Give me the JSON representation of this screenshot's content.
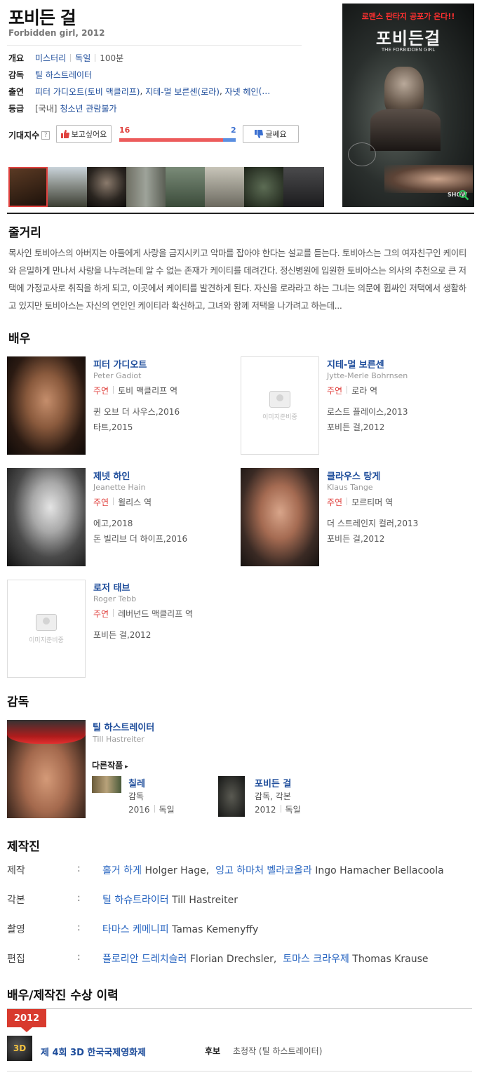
{
  "movie": {
    "title": "포비든 걸",
    "subtitle": "Forbidden girl, 2012"
  },
  "info": {
    "overview_label": "개요",
    "genre": "미스터리",
    "country": "독일",
    "runtime": "100분",
    "director_label": "감독",
    "director": "틸 하스트레이터",
    "cast_label": "출연",
    "cast_line": [
      {
        "name": "피터 가디오트",
        "role": "(토비 맥클리프)"
      },
      {
        "name": "지테-멀 보른센",
        "role": "(로라)"
      },
      {
        "name": "자넷 헤인",
        "role": "(…"
      }
    ],
    "rating_label": "등급",
    "rating_region": "[국내]",
    "rating": "청소년 관람불가"
  },
  "expectation": {
    "label": "기대지수",
    "help": "?",
    "like_button": "보고싶어요",
    "dislike_button": "글쎄요",
    "like_count": "16",
    "dislike_count": "2",
    "like_ratio": 0.89,
    "like_color": "#ec5b5b",
    "dislike_color": "#5a8ee0"
  },
  "poster": {
    "tagline": "로맨스 판타지 공포가 온다!!",
    "title": "포비든걸",
    "eng_title": "THE FORBIDDEN GIRL",
    "corner_logo": "SHOW"
  },
  "synopsis": {
    "heading": "줄거리",
    "text": "목사인 토비아스의 아버지는 아들에게 사랑을 금지시키고 악마를 잡아야 한다는 설교를 듣는다. 토비아스는 그의 여자친구인 케이티와 은밀하게 만나서 사랑을 나누려는데 알 수 없는 존재가 케이티를 데려간다. 정신병원에 입원한 토비아스는 의사의 추천으로 큰 저택에 가정교사로 취직을 하게 되고, 이곳에서 케이티를 발견하게 된다. 자신을 로라라고 하는 그녀는 의문에 휩싸인 저택에서 생활하고 있지만 토비아스는 자신의 연인인 케이티라 확신하고, 그녀와 함께 저택을 나가려고 하는데..."
  },
  "cast": {
    "heading": "배우",
    "no_image_text": "이미지준비중",
    "items": [
      {
        "name": "피터 가디오트",
        "eng": "Peter Gadiot",
        "type": "주연",
        "role": "토비 맥클리프 역",
        "works": [
          "퀸 오브 더 사우스,2016",
          "타트,2015"
        ]
      },
      {
        "name": "지테-멀 보른센",
        "eng": "Jytte-Merle Bohrnsen",
        "type": "주연",
        "role": "로라 역",
        "works": [
          "로스트 플레이스,2013",
          "포비든 걸,2012"
        ]
      },
      {
        "name": "제넷 하인",
        "eng": "Jeanette Hain",
        "type": "주연",
        "role": "윌리스 역",
        "works": [
          "에고,2018",
          "돈 빌리브 더 하이프,2016"
        ]
      },
      {
        "name": "클라우스 탕게",
        "eng": "Klaus Tange",
        "type": "주연",
        "role": "모르티머 역",
        "works": [
          "더 스트레인지 컬러,2013",
          "포비든 걸,2012"
        ]
      },
      {
        "name": "로저 태브",
        "eng": "Roger Tebb",
        "type": "주연",
        "role": "레버넌드 맥클리프 역",
        "works": [
          "포비든 걸,2012"
        ]
      }
    ]
  },
  "director_section": {
    "heading": "감독",
    "name": "틸 하스트레이터",
    "eng": "Till Hastreiter",
    "other_works_label": "다른작품",
    "works": [
      {
        "title": "칠레",
        "role": "감독",
        "year": "2016",
        "country": "독일"
      },
      {
        "title": "포비든 걸",
        "role": "감독, 각본",
        "year": "2012",
        "country": "독일"
      }
    ]
  },
  "crew": {
    "heading": "제작진",
    "rows": [
      {
        "label": "제작",
        "colon": ":",
        "people": [
          {
            "ko": "홀거 하게",
            "en": "Holger Hage"
          },
          {
            "ko": "잉고 하마처 벨라코올라",
            "en": "Ingo Hamacher Bellacoola"
          }
        ]
      },
      {
        "label": "각본",
        "colon": ":",
        "people": [
          {
            "ko": "틸 하슈트라이터",
            "en": "Till Hastreiter"
          }
        ]
      },
      {
        "label": "촬영",
        "colon": ":",
        "people": [
          {
            "ko": "타마스 케메니피",
            "en": "Tamas Kemenyffy"
          }
        ]
      },
      {
        "label": "편집",
        "colon": ":",
        "people": [
          {
            "ko": "플로리안 드레치슬러",
            "en": "Florian Drechsler"
          },
          {
            "ko": "토마스 크라우제",
            "en": "Thomas Krause"
          }
        ]
      }
    ]
  },
  "awards": {
    "heading": "배우/제작진 수상 이력",
    "year": "2012",
    "festival": "제 4회 3D 한국국제영화제",
    "category": "후보",
    "detail": "초청작 (틸 하스트레이터)"
  }
}
